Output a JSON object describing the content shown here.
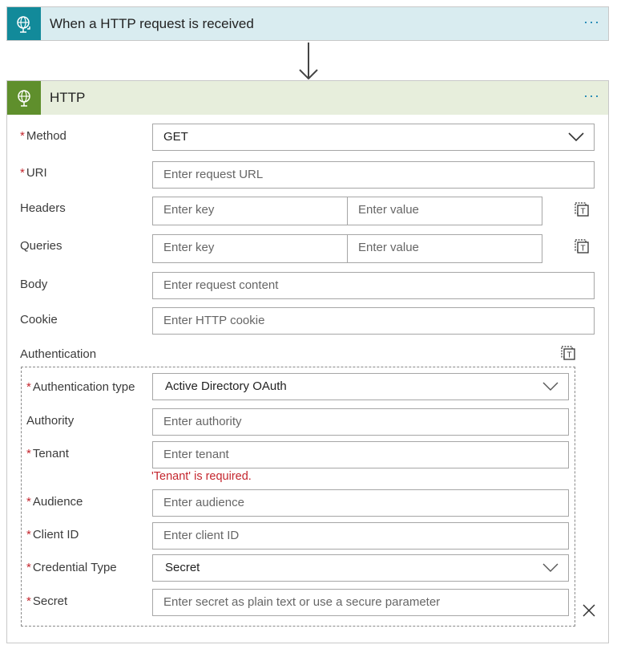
{
  "trigger": {
    "title": "When a HTTP request is received",
    "icon": "globe-request-icon",
    "more": "···"
  },
  "action": {
    "title": "HTTP",
    "icon": "globe-icon",
    "more": "···"
  },
  "form": {
    "method": {
      "label": "Method",
      "value": "GET"
    },
    "uri": {
      "label": "URI",
      "placeholder": "Enter request URL"
    },
    "headers": {
      "label": "Headers",
      "key_placeholder": "Enter key",
      "value_placeholder": "Enter value"
    },
    "queries": {
      "label": "Queries",
      "key_placeholder": "Enter key",
      "value_placeholder": "Enter value"
    },
    "body": {
      "label": "Body",
      "placeholder": "Enter request content"
    },
    "cookie": {
      "label": "Cookie",
      "placeholder": "Enter HTTP cookie"
    },
    "authentication": {
      "label": "Authentication",
      "type": {
        "label": "Authentication type",
        "value": "Active Directory OAuth"
      },
      "authority": {
        "label": "Authority",
        "placeholder": "Enter authority"
      },
      "tenant": {
        "label": "Tenant",
        "placeholder": "Enter tenant",
        "error": "'Tenant' is required."
      },
      "audience": {
        "label": "Audience",
        "placeholder": "Enter audience"
      },
      "client_id": {
        "label": "Client ID",
        "placeholder": "Enter client ID"
      },
      "credential_type": {
        "label": "Credential Type",
        "value": "Secret"
      },
      "secret": {
        "label": "Secret",
        "placeholder": "Enter secret as plain text or use a secure parameter"
      }
    }
  },
  "required_marker": "*",
  "colors": {
    "trigger_header": "#d9ecf0",
    "trigger_icon_bg": "#128a9a",
    "http_header": "#e7eedc",
    "http_icon_bg": "#5f8f2c",
    "required": "#c4262e",
    "accent": "#0f7fb0"
  }
}
